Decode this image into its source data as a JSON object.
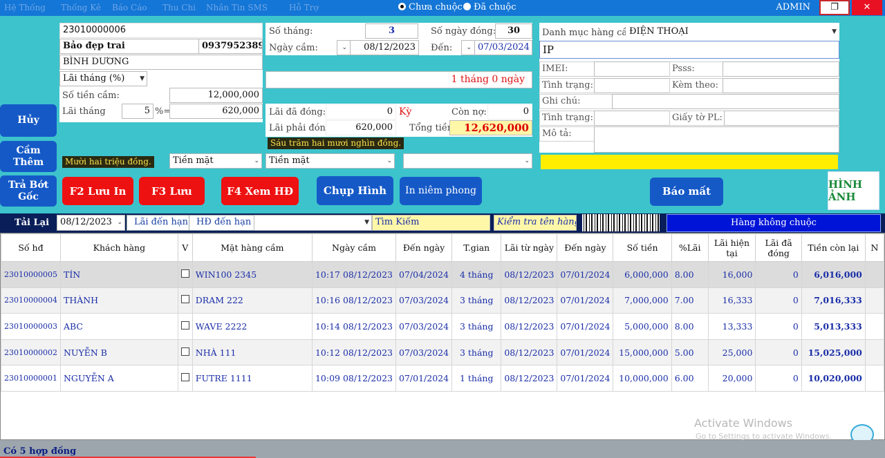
{
  "menu": [
    "Hệ Thống",
    "Thống Kê",
    "Báo Cáo",
    "Thu Chi",
    "Nhắn Tin SMS",
    "Hỗ Trợ"
  ],
  "filter_radio": {
    "unredeemed": "Chưa chuộc",
    "redeemed": "Đã chuộc",
    "selected": "unredeemed"
  },
  "user": "ADMIN",
  "customer": {
    "contract_no": "23010000006",
    "name": "Bảo đẹp trai",
    "phone": "0937952389",
    "address": "BÌNH DƯƠNG",
    "interest_type": "Lãi tháng (%)",
    "loan_label": "Số tiền cầm:",
    "loan_amount": "12,000,000",
    "rate_label": "Lãi tháng",
    "rate": "5",
    "rate_suffix": "%=",
    "interest_amount": "620,000",
    "amount_words": "Mười hai triệu đồng.",
    "payment_method": "Tiền mặt"
  },
  "term": {
    "months_label": "Số tháng:",
    "months": "3",
    "days_label": "Số ngày đóng:",
    "days": "30",
    "pawn_date_label": "Ngày cầm:",
    "pawn_date": "08/12/2023",
    "to_label": "Đến:",
    "to_date": "07/03/2024",
    "duration_text": "1  tháng  0   ngày",
    "paid_label": "Lãi đã đóng:",
    "paid": "0",
    "period_label": "Kỳ",
    "remaining_label": "Còn nợ:",
    "remaining": "0",
    "due_label": "Lãi phải đóng:",
    "due": "620,000",
    "total_label": "Tổng tiền:",
    "total": "12,620,000",
    "due_words": "Sáu trăm hai mươi nghìn đồng.",
    "payment_method": "Tiền mặt",
    "payment_method2": ""
  },
  "item": {
    "category_label": "Danh mục hàng cầm",
    "category": "ĐIỆN THOẠI",
    "name": "IP",
    "imei_label": "IMEI:",
    "pass_label": "Psss:",
    "condition_label": "Tình trạng:",
    "accessories_label": "Kèm theo:",
    "note_label": "Ghi chú:",
    "condition2_label": "Tình trạng:",
    "papers_label": "Giấy tờ PL:",
    "desc_label": "Mô tả:"
  },
  "side_buttons": {
    "cancel": "Hủy",
    "pawn_more": "Cầm Thêm",
    "pay_principal": "Trả Bớt Gốc",
    "reload": "Tải Lại"
  },
  "action_buttons": {
    "f2": "F2 Lưu In",
    "f3": "F3 Lưu",
    "f4": "F4 Xem HĐ",
    "photo": "Chụp Hình",
    "seal": "In niêm phong",
    "lost": "Báo mất",
    "image_label": "HÌNH ẢNH"
  },
  "toolbar": {
    "date": "08/12/2023",
    "interest_due": "Lãi đến hạn",
    "contract_due": "HĐ đến hạn",
    "search": "Tìm Kiếm",
    "check_name": "Kiểm tra tên hàng",
    "not_redeemed": "Hàng không chuộc"
  },
  "table": {
    "headers": [
      "Số hđ",
      "Khách hàng",
      "V",
      "Mặt hàng cầm",
      "Ngày cầm",
      "Đến ngày",
      "T.gian",
      "Lãi từ ngày",
      "Đến ngày",
      "Số tiền",
      "%Lãi",
      "Lãi hiện tại",
      "Lãi đã đóng",
      "Tiền còn lại",
      "N"
    ],
    "rows": [
      [
        "23010000005",
        "TÍN",
        "",
        "WIN100 2345",
        "10:17 08/12/2023",
        "07/04/2024",
        "4 tháng",
        "08/12/2023",
        "07/01/2024",
        "6,000,000",
        "8.00",
        "16,000",
        "0",
        "6,016,000"
      ],
      [
        "23010000004",
        "THÀNH",
        "",
        "DRAM 222",
        "10:16 08/12/2023",
        "07/03/2024",
        "3 tháng",
        "08/12/2023",
        "07/01/2024",
        "7,000,000",
        "7.00",
        "16,333",
        "0",
        "7,016,333"
      ],
      [
        "23010000003",
        "ABC",
        "",
        "WAVE 2222",
        "10:14 08/12/2023",
        "07/03/2024",
        "3 tháng",
        "08/12/2023",
        "07/01/2024",
        "5,000,000",
        "8.00",
        "13,333",
        "0",
        "5,013,333"
      ],
      [
        "23010000002",
        "NUYỄN B",
        "",
        "NHÀ 111",
        "10:12 08/12/2023",
        "07/03/2024",
        "3 tháng",
        "08/12/2023",
        "07/01/2024",
        "15,000,000",
        "5.00",
        "25,000",
        "0",
        "15,025,000"
      ],
      [
        "23010000001",
        "NGUYỄN A",
        "",
        "FUTRE 1111",
        "10:09 08/12/2023",
        "07/01/2024",
        "1 tháng",
        "08/12/2023",
        "07/01/2024",
        "10,000,000",
        "6.00",
        "20,000",
        "0",
        "10,020,000"
      ]
    ]
  },
  "status": "Có 5 hợp đồng",
  "watermark": {
    "title": "Activate Windows",
    "subtitle": "Go to Settings to activate Windows."
  },
  "colors": {
    "bg": "#3dc3cc",
    "accent_blue": "#1559c7",
    "accent_red": "#ee1111",
    "total_red": "#e00000"
  }
}
